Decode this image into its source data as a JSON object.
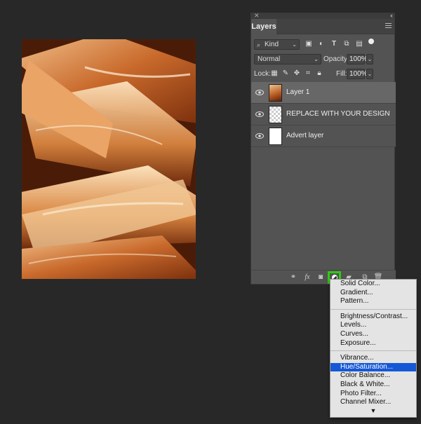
{
  "panel": {
    "title": "Layers",
    "filter": {
      "kind_label": "Kind"
    },
    "blend_mode": "Normal",
    "opacity_label": "Opacity:",
    "opacity_value": "100%",
    "lock_label": "Lock:",
    "fill_label": "Fill:",
    "fill_value": "100%",
    "layers": [
      {
        "name": "Layer 1",
        "selected": true
      },
      {
        "name": "REPLACE WITH YOUR DESIGN",
        "selected": false
      },
      {
        "name": "Advert layer",
        "selected": false
      }
    ]
  },
  "menu": {
    "groups": [
      [
        "Solid Color...",
        "Gradient...",
        "Pattern..."
      ],
      [
        "Brightness/Contrast...",
        "Levels...",
        "Curves...",
        "Exposure..."
      ],
      [
        "Vibrance...",
        "Hue/Saturation...",
        "Color Balance...",
        "Black & White...",
        "Photo Filter...",
        "Channel Mixer..."
      ]
    ],
    "highlighted": "Hue/Saturation...",
    "more_indicator": "▼"
  },
  "colors": {
    "highlight": "#1558d6",
    "callout_box": "#2ecc12",
    "panel_bg": "#535353",
    "workspace_bg": "#282828"
  }
}
